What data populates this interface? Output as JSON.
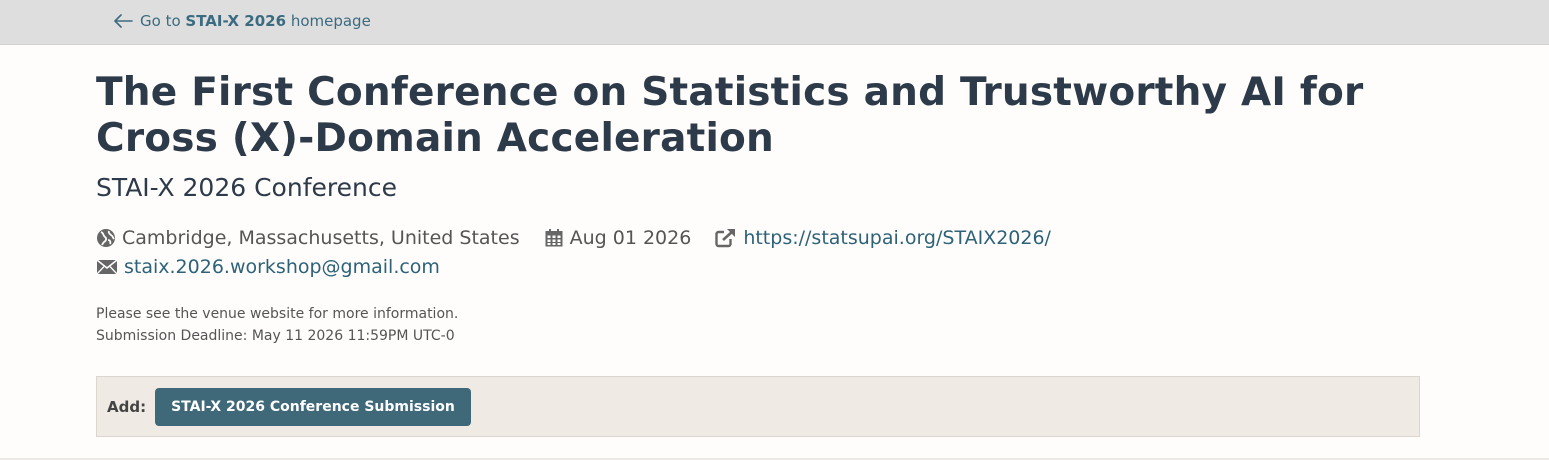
{
  "topbar": {
    "back_prefix": "Go to",
    "back_venue": "STAI-X 2026",
    "back_suffix": "homepage"
  },
  "venue": {
    "title": "The First Conference on Statistics and Trustworthy AI for Cross (X)-Domain Acceleration",
    "subtitle": "STAI-X 2026 Conference",
    "location": "Cambridge, Massachusetts, United States",
    "date": "Aug 01 2026",
    "website": "https://statsupai.org/STAIX2026/",
    "email": "staix.2026.workshop@gmail.com",
    "note": "Please see the venue website for more information.",
    "deadline": "Submission Deadline: May 11 2026 11:59PM UTC-0"
  },
  "add_bar": {
    "label": "Add:",
    "button_label": "STAI-X 2026 Conference Submission"
  },
  "icons": {
    "back": "arrow-left-icon",
    "location": "globe-icon",
    "date": "calendar-icon",
    "website": "external-link-icon",
    "email": "envelope-icon"
  },
  "colors": {
    "topbar_bg": "#dedede",
    "link": "#2d6279",
    "button_bg": "#3f6879",
    "add_bar_bg": "#efeae4",
    "title": "#2c3a4a"
  }
}
